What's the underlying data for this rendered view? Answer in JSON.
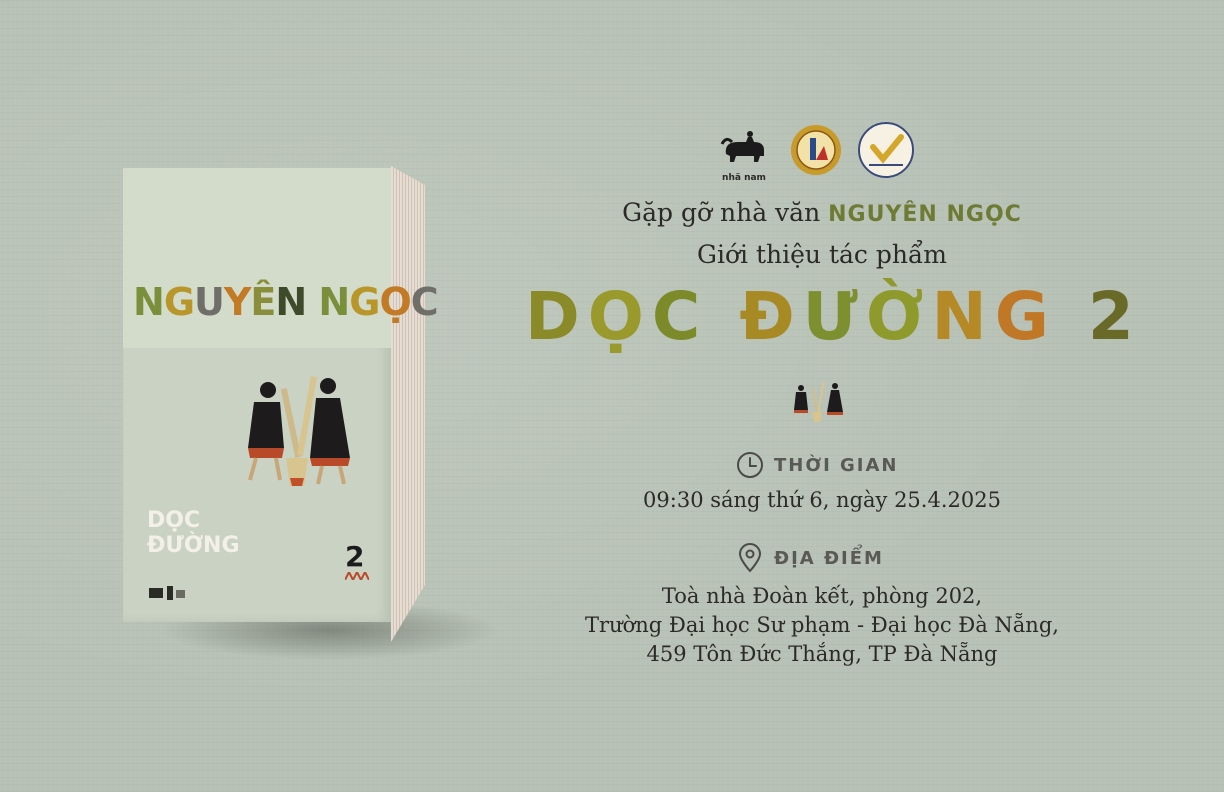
{
  "book": {
    "author_letters": [
      {
        "ch": "N",
        "color": "#7a8f3a"
      },
      {
        "ch": "G",
        "color": "#b8962a"
      },
      {
        "ch": "U",
        "color": "#6f6e68"
      },
      {
        "ch": "Y",
        "color": "#c27a24"
      },
      {
        "ch": "Ê",
        "color": "#8a8d3a"
      },
      {
        "ch": "N",
        "color": "#3f4a2a"
      },
      {
        "ch": " ",
        "color": "#000000"
      },
      {
        "ch": "N",
        "color": "#7a8f3a"
      },
      {
        "ch": "G",
        "color": "#b8962a"
      },
      {
        "ch": "Ọ",
        "color": "#c27a24"
      },
      {
        "ch": "C",
        "color": "#6f6e68"
      }
    ],
    "title_lines": [
      "DỌC",
      "ĐƯỜNG"
    ],
    "volume": "2"
  },
  "header": {
    "line1_prefix": "Gặp gỡ nhà văn",
    "line1_name": "NGUYÊN NGỌC",
    "line2": "Giới thiệu tác phẩm"
  },
  "title_letters": [
    {
      "ch": "D",
      "color": "#8a8a28"
    },
    {
      "ch": "Ọ",
      "color": "#9a9a2c"
    },
    {
      "ch": "C",
      "color": "#7c8a2a"
    },
    {
      "ch": " ",
      "color": "#000000"
    },
    {
      "ch": "Đ",
      "color": "#a88a24"
    },
    {
      "ch": "Ư",
      "color": "#7d8f2e"
    },
    {
      "ch": "Ờ",
      "color": "#8f9a2c"
    },
    {
      "ch": "N",
      "color": "#b58a26"
    },
    {
      "ch": "G",
      "color": "#c07826"
    },
    {
      "ch": " ",
      "color": "#000000"
    },
    {
      "ch": "2",
      "color": "#6a6a28"
    }
  ],
  "time": {
    "heading": "THỜI GIAN",
    "text": "09:30 sáng thứ 6, ngày 25.4.2025"
  },
  "place": {
    "heading": "ĐỊA ĐIỂM",
    "lines": [
      "Toà nhà Đoàn kết, phòng 202,",
      "Trường Đại học Sư phạm - Đại học Đà Nẵng,",
      "459 Tôn Đức Thắng, TP Đà Nẵng"
    ]
  },
  "logos": {
    "publisher": "nhã nam"
  },
  "icons": [
    "clock-icon",
    "location-pin-icon"
  ]
}
